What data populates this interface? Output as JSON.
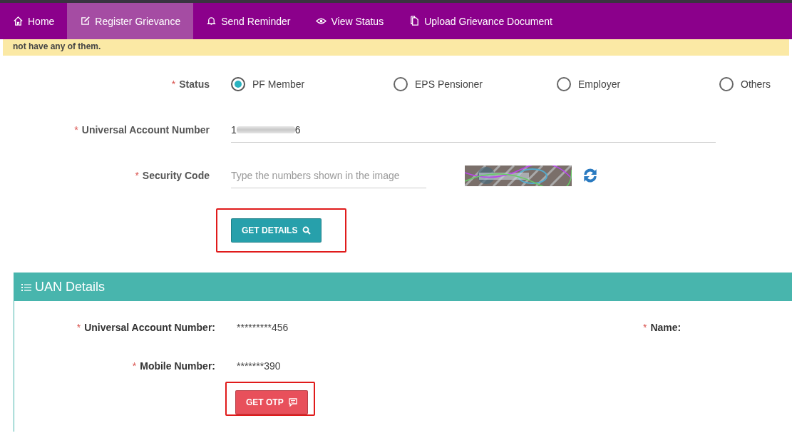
{
  "nav": [
    {
      "label": "Home",
      "selected": false
    },
    {
      "label": "Register Grievance",
      "selected": true
    },
    {
      "label": "Send Reminder",
      "selected": false
    },
    {
      "label": "View Status",
      "selected": false
    },
    {
      "label": "Upload Grievance Document",
      "selected": false
    }
  ],
  "notice": "not have any of them.",
  "form": {
    "status": {
      "required_mark": "*",
      "label": "Status",
      "options": [
        {
          "label": "PF Member",
          "selected": true
        },
        {
          "label": "EPS Pensioner",
          "selected": false
        },
        {
          "label": "Employer",
          "selected": false
        },
        {
          "label": "Others",
          "selected": false
        }
      ]
    },
    "uan": {
      "required_mark": "*",
      "label": "Universal Account Number",
      "value_start": "1",
      "value_end": "6"
    },
    "security_code": {
      "required_mark": "*",
      "label": "Security Code",
      "placeholder": "Type the numbers shown in the image"
    },
    "button": "GET DETAILS"
  },
  "uan_details": {
    "title": "UAN Details",
    "rows": [
      {
        "required_mark": "*",
        "label": "Universal Account Number:",
        "value": "*********456"
      },
      {
        "required_mark": "*",
        "label": "Mobile Number:",
        "value": "*******390"
      }
    ],
    "name": {
      "required_mark": "*",
      "label": "Name:"
    },
    "button": "GET OTP"
  }
}
